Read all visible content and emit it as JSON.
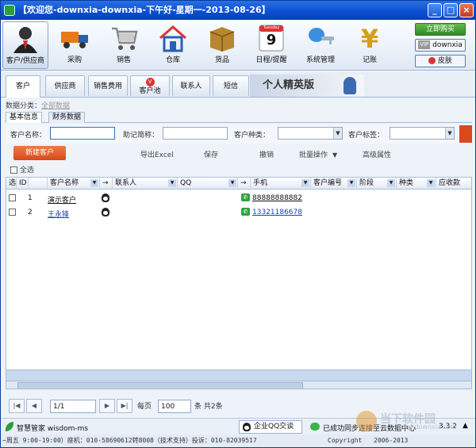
{
  "window": {
    "title": "【欢迎您-downxia-downxia-下午好-星期一-2013-08-26】"
  },
  "toolbar": {
    "items": [
      {
        "label": "客户/供应商",
        "icon": "user-icon"
      },
      {
        "label": "采购",
        "icon": "truck-icon"
      },
      {
        "label": "销售",
        "icon": "cart-icon"
      },
      {
        "label": "仓库",
        "icon": "house-icon"
      },
      {
        "label": "货品",
        "icon": "box-icon"
      },
      {
        "label": "日程/提醒",
        "icon": "calendar-icon",
        "day": "Tuesday",
        "date": "9"
      },
      {
        "label": "系统管理",
        "icon": "key-icon"
      },
      {
        "label": "记账",
        "icon": "yen-icon"
      }
    ],
    "buy_label": "立即购买",
    "user_label": "downxia",
    "vip_label": "VIP",
    "skin_label": "皮肤"
  },
  "tabs": [
    "客户",
    "供应商",
    "销售费用",
    "客户池",
    "联系人",
    "短信"
  ],
  "banner": "个人精英版",
  "category": {
    "label": "数据分类：",
    "value": "全部数据"
  },
  "subtabs": [
    "基本信息",
    "财务数据"
  ],
  "filters": {
    "name_label": "客户名称：",
    "mnemonic_label": "助记简称：",
    "type_label": "客户种类：",
    "tag_label": "客户标签："
  },
  "actions": {
    "new": "新建客户",
    "export": "导出Excel",
    "save": "保存",
    "undo": "撤销",
    "batch": "批量操作",
    "advanced": "高级属性"
  },
  "select_all": "全选",
  "grid": {
    "columns": [
      "选",
      "ID",
      "客户名称",
      "→",
      "联系人",
      "QQ",
      "→",
      "手机",
      "客户编号",
      "阶段",
      "种类",
      "应收款"
    ],
    "rows": [
      {
        "id": "1",
        "name": "演示客户",
        "phone": "88888888882"
      },
      {
        "id": "2",
        "name": "王永锋",
        "phone": "13321186678"
      }
    ]
  },
  "pager": {
    "page": "1/1",
    "per_page_label": "每页",
    "per_page": "100",
    "total": "条 共2条"
  },
  "status1": {
    "brand": "智慧管家 wisdom-ms",
    "qq": "企业QQ交谈",
    "sync": "已成功同步连接至云数据中心",
    "version": "3.3.2",
    "watermark": "当下软件园",
    "site": "www.downxia.com"
  },
  "status2": {
    "text": "~周五 9:00-19:00）座机：010-58690612转8008（技术支持）投诉：010-82039517",
    "copyright": "Copyright",
    "years": "2006-2013"
  }
}
